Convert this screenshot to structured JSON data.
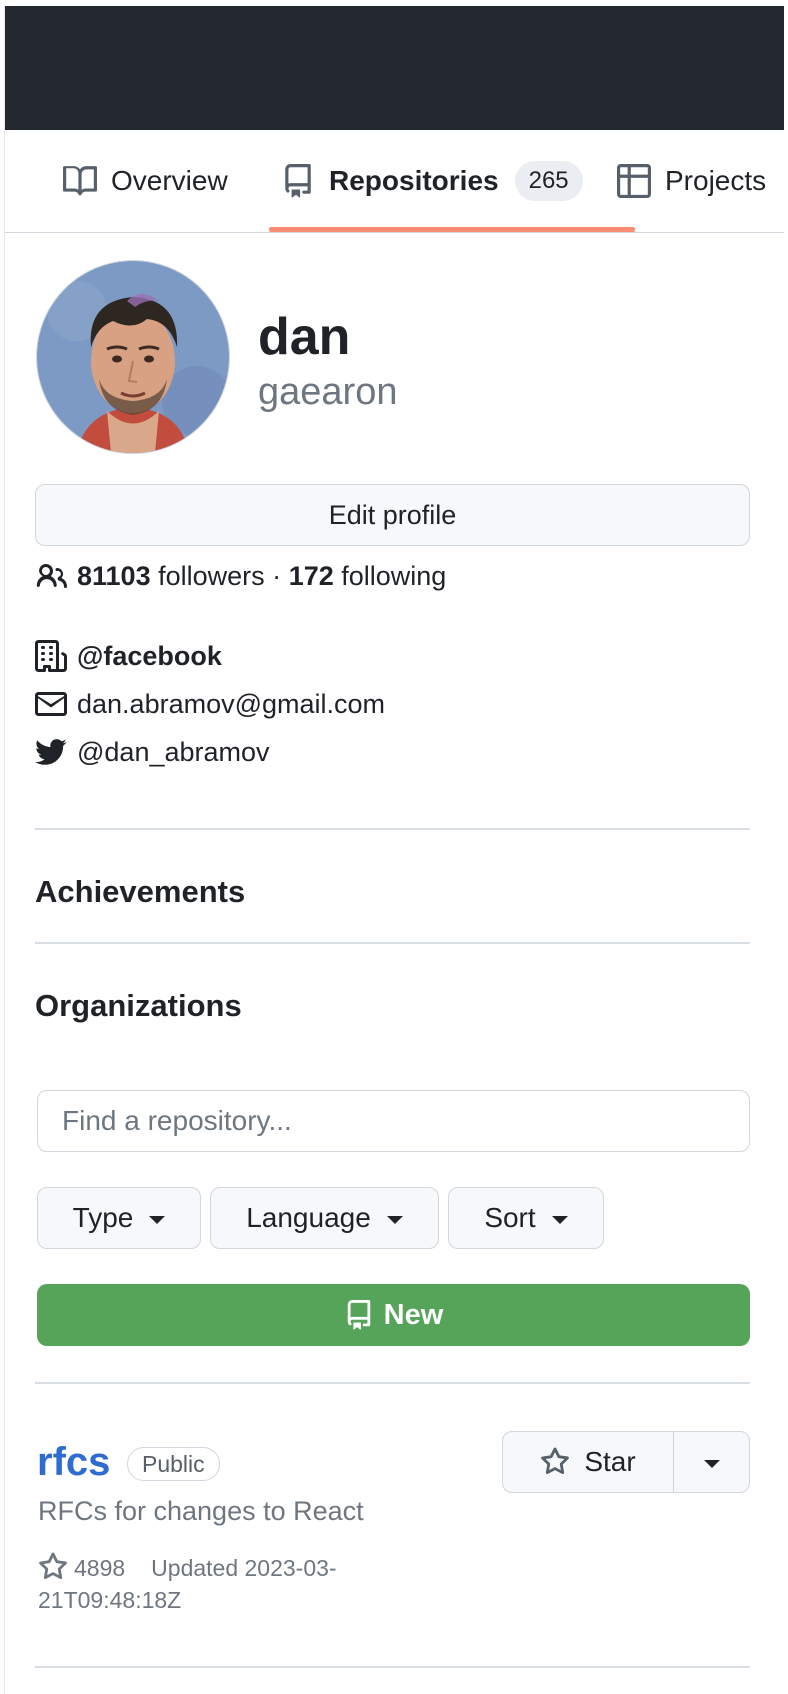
{
  "nav": {
    "tabs": [
      {
        "label": "Overview",
        "icon": "book-icon"
      },
      {
        "label": "Repositories",
        "icon": "repo-icon",
        "count": "265",
        "active": true
      },
      {
        "label": "Projects",
        "icon": "project-icon"
      }
    ]
  },
  "profile": {
    "name": "dan",
    "login": "gaearon",
    "edit_label": "Edit profile",
    "followers_count": "81103",
    "followers_label": "followers",
    "separator": "·",
    "following_count": "172",
    "following_label": "following",
    "organization": "@facebook",
    "email": "dan.abramov@gmail.com",
    "twitter": "@dan_abramov"
  },
  "sections": {
    "achievements": "Achievements",
    "organizations": "Organizations"
  },
  "filters": {
    "search_placeholder": "Find a repository...",
    "type_label": "Type",
    "language_label": "Language",
    "sort_label": "Sort",
    "new_label": "New"
  },
  "repos": [
    {
      "name": "rfcs",
      "visibility": "Public",
      "description": "RFCs for changes to React",
      "stars": "4898",
      "updated": "Updated 2023-03-21T09:48:18Z",
      "star_button_label": "Star"
    }
  ],
  "colors": {
    "topbar": "#24292f",
    "underline": "#fd8c73",
    "new_button": "#55a459",
    "repo_link": "#2f6cd1"
  }
}
